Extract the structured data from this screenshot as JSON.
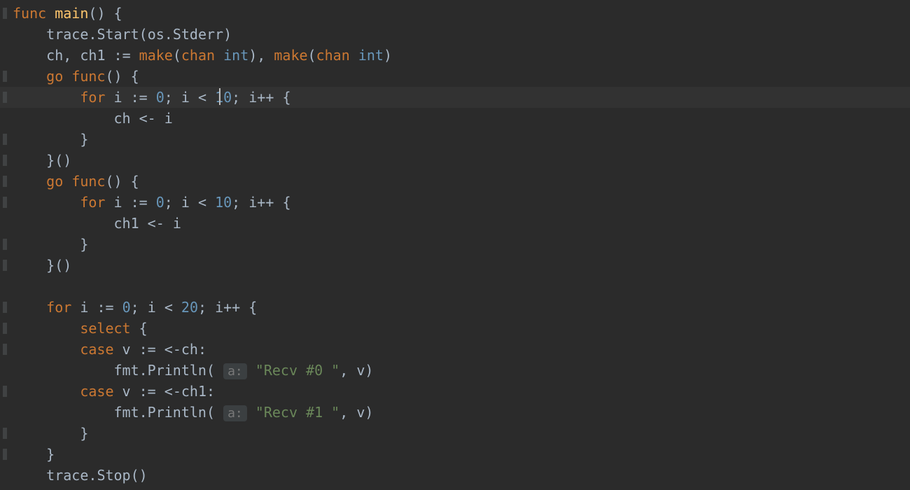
{
  "code": {
    "kw_func": "func",
    "kw_go": "go",
    "kw_for": "for",
    "kw_select": "select",
    "kw_case": "case",
    "kw_make": "make",
    "kw_chan": "chan",
    "typ_int": "int",
    "fn_main": "main",
    "id_trace": "trace",
    "id_Start": "Start",
    "id_Stop": "Stop",
    "id_os": "os",
    "id_Stderr": "Stderr",
    "id_fmt": "fmt",
    "id_Println": "Println",
    "id_ch": "ch",
    "id_ch1": "ch1",
    "id_i": "i",
    "id_v": "v",
    "num_0": "0",
    "num_10": "10",
    "num_1": "1",
    "num_0b": "0",
    "num_20": "20",
    "op_assign": ":=",
    "op_lt": "<",
    "op_inc": "++",
    "op_send": "<-",
    "op_recv": "<-",
    "hint_a": "a:",
    "str_recv0": "\"Recv #0 \"",
    "str_recv1": "\"Recv #1 \"",
    "brace_open": "{",
    "brace_close": "}",
    "paren_open": "(",
    "paren_close": ")",
    "paren_call": "()",
    "comma": ",",
    "semi": ";",
    "colon": ":",
    "dot": "."
  }
}
